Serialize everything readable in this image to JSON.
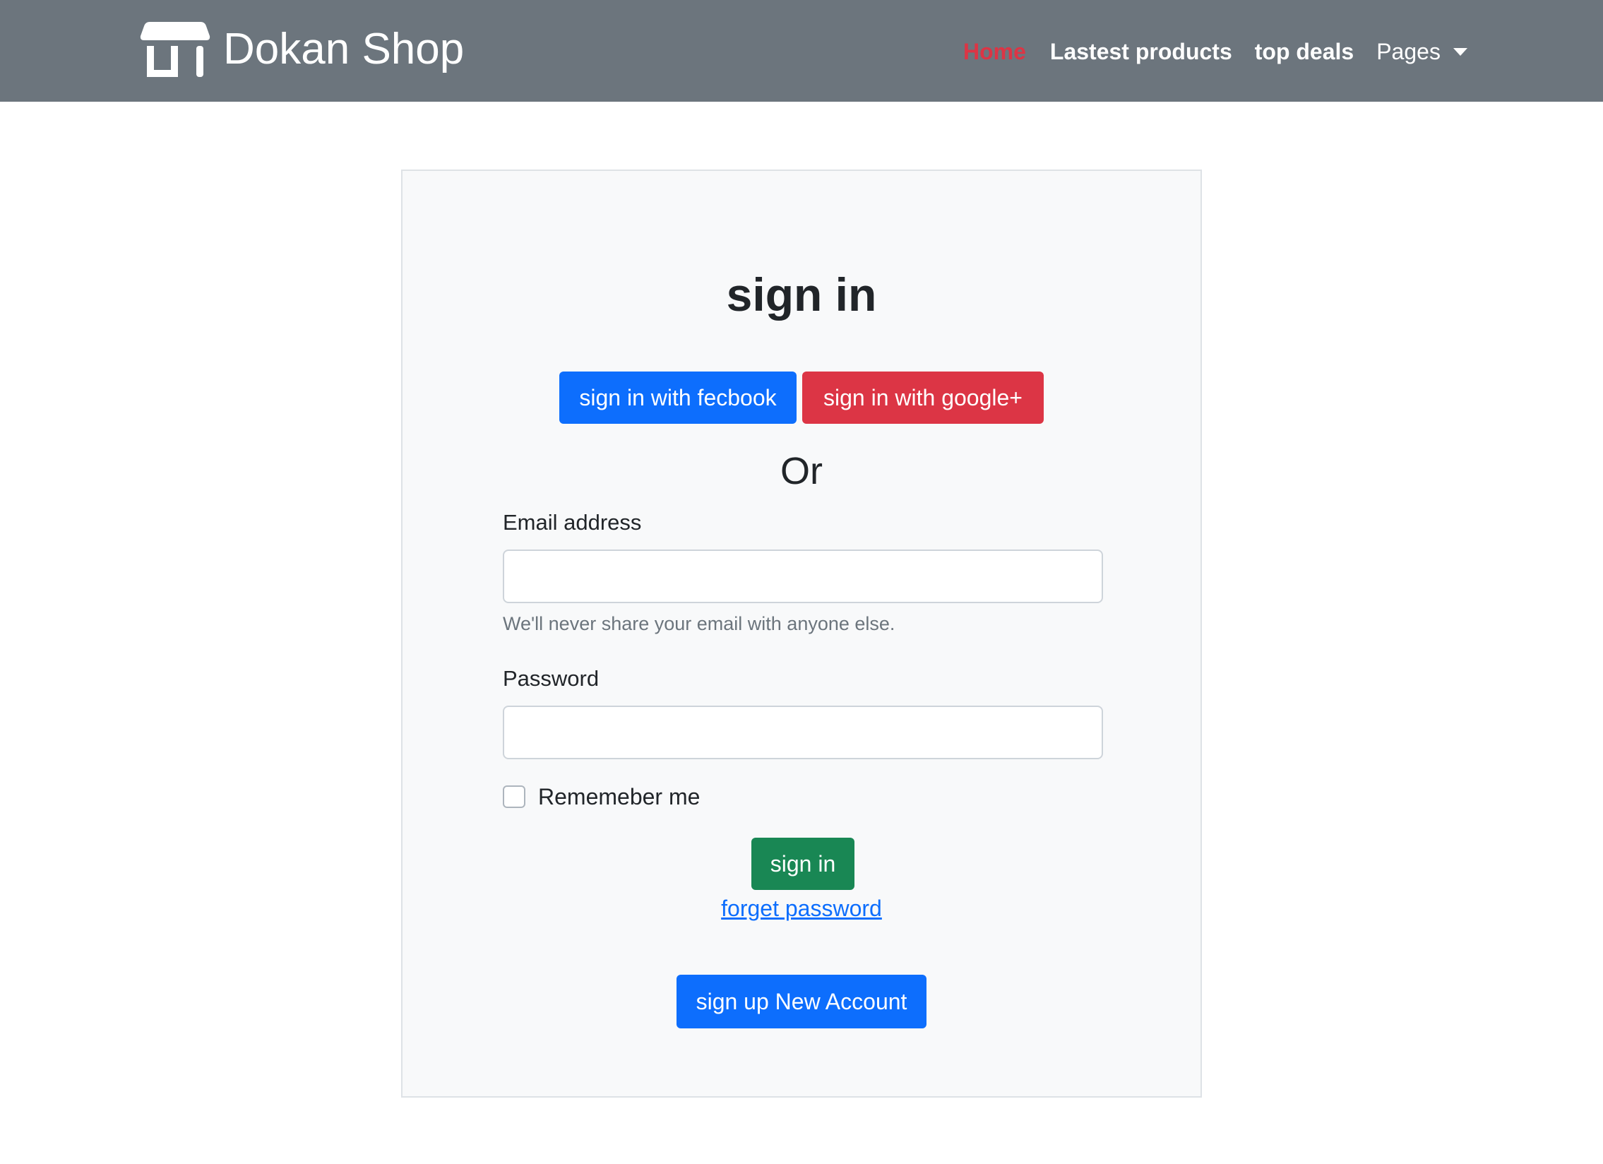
{
  "navbar": {
    "brand": "Dokan Shop",
    "brand_icon": "shop-icon",
    "links": [
      {
        "label": "Home",
        "active": true
      },
      {
        "label": "Lastest products",
        "active": false
      },
      {
        "label": "top deals",
        "active": false
      },
      {
        "label": "Pages",
        "active": false,
        "dropdown": true
      }
    ]
  },
  "signin": {
    "title": "sign in",
    "facebook_button": "sign in with fecbook",
    "google_button": "sign in with google+",
    "divider": "Or",
    "email_label": "Email address",
    "email_value": "",
    "email_help": "We'll never share your email with anyone else.",
    "password_label": "Password",
    "password_value": "",
    "remember_label": "Rememeber me",
    "remember_checked": false,
    "submit_button": "sign in",
    "forgot_link": "forget password",
    "signup_button": "sign up New Account"
  },
  "colors": {
    "navbar_bg": "#6c757d",
    "primary": "#0d6efd",
    "danger": "#dc3545",
    "success": "#198754",
    "card_bg": "#f8f9fa"
  }
}
